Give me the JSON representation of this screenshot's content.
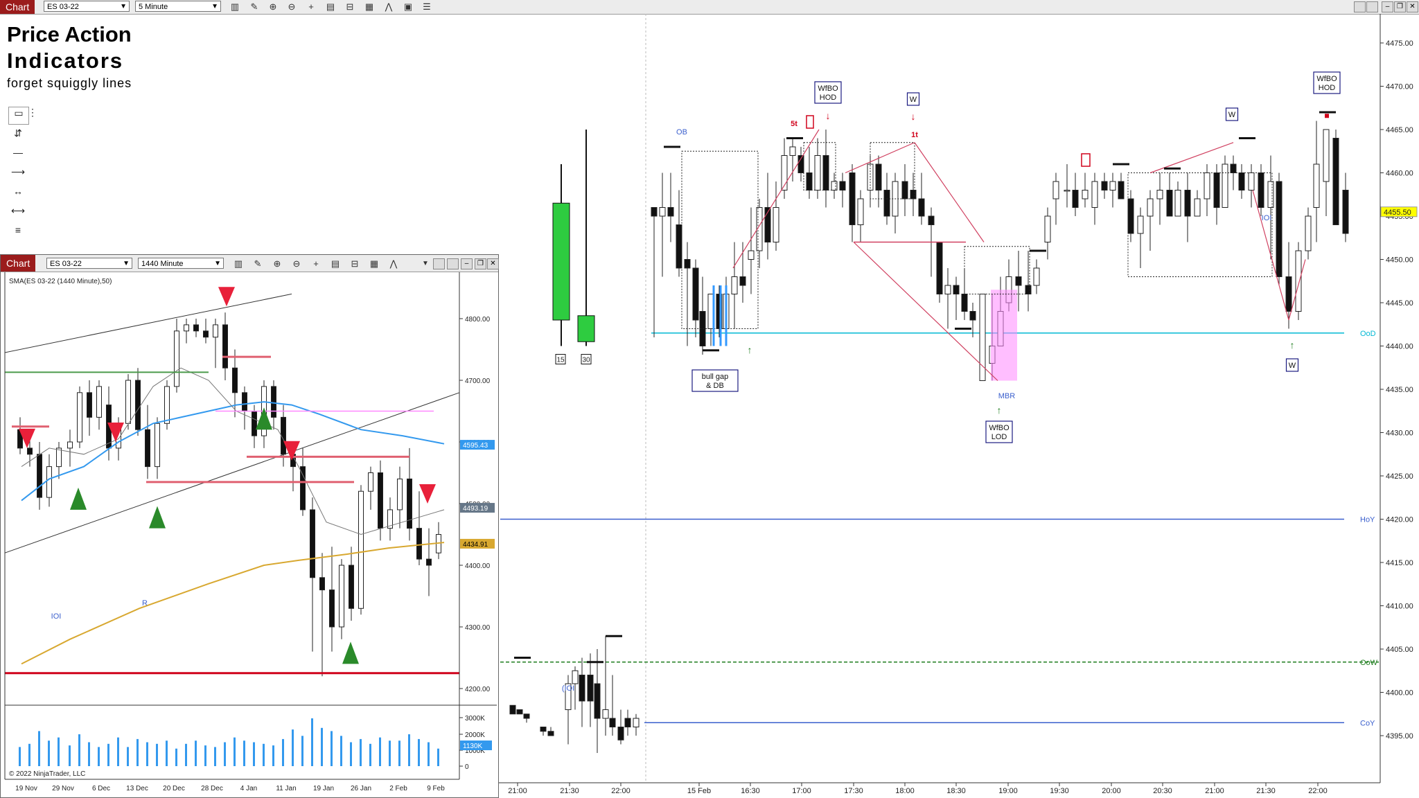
{
  "toolbar": {
    "chart_tab": "Chart",
    "instrument": "ES 03-22",
    "interval": "5 Minute"
  },
  "overlay": {
    "title_line1": "Price Action",
    "title_line2": "Indicators",
    "subtitle": "forget squiggly lines"
  },
  "main_chart": {
    "price_labels": [
      "4475.00",
      "4470.00",
      "4465.00",
      "4460.00",
      "4455.00",
      "4450.00",
      "4445.00",
      "4440.00",
      "4435.00",
      "4430.00",
      "4425.00",
      "4420.00",
      "4415.00",
      "4410.00",
      "4405.00",
      "4400.00",
      "4395.00"
    ],
    "current_price": "4455.50",
    "time_labels": [
      "21:00",
      "21:30",
      "22:00",
      "15 Feb",
      "16:30",
      "17:00",
      "17:30",
      "18:00",
      "18:30",
      "19:00",
      "19:30",
      "20:00",
      "20:30",
      "21:00",
      "21:30",
      "22:00"
    ],
    "levels": [
      "OoD",
      "HoY",
      "OoW",
      "CoY"
    ],
    "annotations": {
      "ob": "OB",
      "wfbo_hod_1": "WfBO HOD",
      "w_1": "W",
      "five_t": "5t",
      "one_t": "1t",
      "bull_gap": "bull gap & DB",
      "mbr": "MBR",
      "wfbo_lod": "WfBO LOD",
      "w_2": "W",
      "wfbo_hod_2": "WfBO HOD",
      "ioi_1": "IOI",
      "w_3": "W",
      "ioi_2": "(IOI",
      "box_15": "15",
      "box_30": "30"
    },
    "colors": {
      "up": "#2ecc40",
      "down": "#111111",
      "level_blue": "#3a5fcd",
      "level_cyan": "#00b8d4",
      "level_green": "#1e7d1e",
      "pink": "#ff88ff",
      "red": "#d0021b"
    }
  },
  "sub_chart": {
    "tab": "Chart",
    "instrument": "ES 03-22",
    "interval": "1440 Minute",
    "indicator_label": "SMA(ES 03-22 (1440 Minute),50)",
    "price_labels": [
      "4800.00",
      "4700.00",
      "4600.00",
      "4500.00",
      "4400.00",
      "4300.00",
      "4200.00"
    ],
    "price_badges": [
      "4595.43",
      "4493.19",
      "4434.91"
    ],
    "volume_labels": [
      "3000K",
      "2000K",
      "1000K",
      "0"
    ],
    "volume_badge": "1130K",
    "time_labels": [
      "19 Nov",
      "29 Nov",
      "6 Dec",
      "13 Dec",
      "20 Dec",
      "28 Dec",
      "4 Jan",
      "11 Jan",
      "19 Jan",
      "26 Jan",
      "2 Feb",
      "9 Feb"
    ],
    "ioi_label": "IOI",
    "r_label": "R",
    "copyright": "© 2022 NinjaTrader, LLC"
  }
}
